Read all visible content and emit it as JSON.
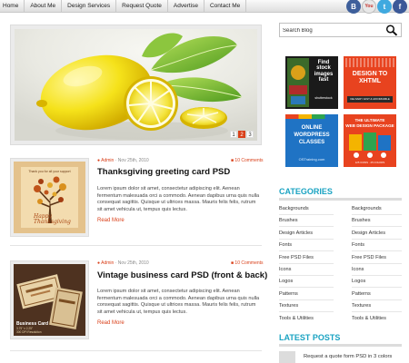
{
  "nav": {
    "items": [
      "Home",
      "About Me",
      "Design Services",
      "Request Quote",
      "Advertise",
      "Contact Me"
    ]
  },
  "social": [
    {
      "icon": "blogger-icon",
      "glyph": "B"
    },
    {
      "icon": "youtube-icon",
      "glyph": "You"
    },
    {
      "icon": "twitter-icon",
      "glyph": "t"
    },
    {
      "icon": "facebook-icon",
      "glyph": "f"
    }
  ],
  "slider": {
    "pages": [
      "1",
      "2",
      "3"
    ],
    "active_page": "2"
  },
  "posts": [
    {
      "author": "Admin",
      "date": "Nov 25th, 2010",
      "comments": "10 Comments",
      "title": "Thanksgiving greeting card PSD",
      "excerpt": "Lorem ipsum dolor sit amet, consectetur adipiscing elit. Aenean fermentum malesuada orci a commodo. Aenean dapibus urna quis nulla consequat sagittis. Quisque ut ultrices massa. Mauris felis felis, rutrum sit amet vehicula ut, tempus quis lectus.",
      "read_more": "Read More",
      "thumb_text_top": "Thank you for all your support",
      "thumb_text_script": "Happy Thanksgiving"
    },
    {
      "author": "Admin",
      "date": "Nov 25th, 2010",
      "comments": "10 Comments",
      "title": "Vintage business card PSD (front & back)",
      "excerpt": "Lorem ipsum dolor sit amet, consectetur adipiscing elit. Aenean fermentum malesuada orci a commodo. Aenean dapibus urna quis nulla consequat sagittis. Quisque ut ultrices massa. Mauris felis felis, rutrum sit amet vehicula ut, tempus quis lectus.",
      "read_more": "Read More",
      "thumb_caption": "Business Card",
      "thumb_sub": "3.75\" x 2.25\"\n300 DPI Resolution"
    }
  ],
  "search": {
    "placeholder": "Search Blog",
    "value": "Search Blog"
  },
  "ads": [
    {
      "line1": "Find",
      "line2": "stock",
      "line3": "images",
      "line4": "fast",
      "brand": "shutterstock"
    },
    {
      "line1": "DESIGN TO",
      "line2": "XHTML",
      "brand": "DELIVERY FAST & AFFORDABLE"
    },
    {
      "line1": "ONLINE",
      "line2": "WORDPRESS",
      "line3": "CLASSES",
      "brand": "OSTraining.com"
    },
    {
      "line1": "THE ULTIMATE",
      "line2": "WEB DESIGN PACKAGE",
      "brand": "125 ICONS · 25 COLORS"
    }
  ],
  "categories": {
    "heading": "CATEGORIES",
    "left": [
      "Backgrounds",
      "Brushes",
      "Design Articles",
      "Fonts",
      "Free PSD Files",
      "Icons",
      "Logos",
      "Patterns",
      "Textures",
      "Tools & Utilities"
    ],
    "right": [
      "Backgrounds",
      "Brushes",
      "Design Articles",
      "Fonts",
      "Free PSD Files",
      "Icons",
      "Logos",
      "Patterns",
      "Textures",
      "Tools & Utilities"
    ]
  },
  "latest": {
    "heading": "LATEST POSTS",
    "items": [
      "Request a quote form PSD in 3 colors"
    ]
  },
  "colors": {
    "accent": "#d9401a",
    "heading": "#1aa3c2"
  }
}
